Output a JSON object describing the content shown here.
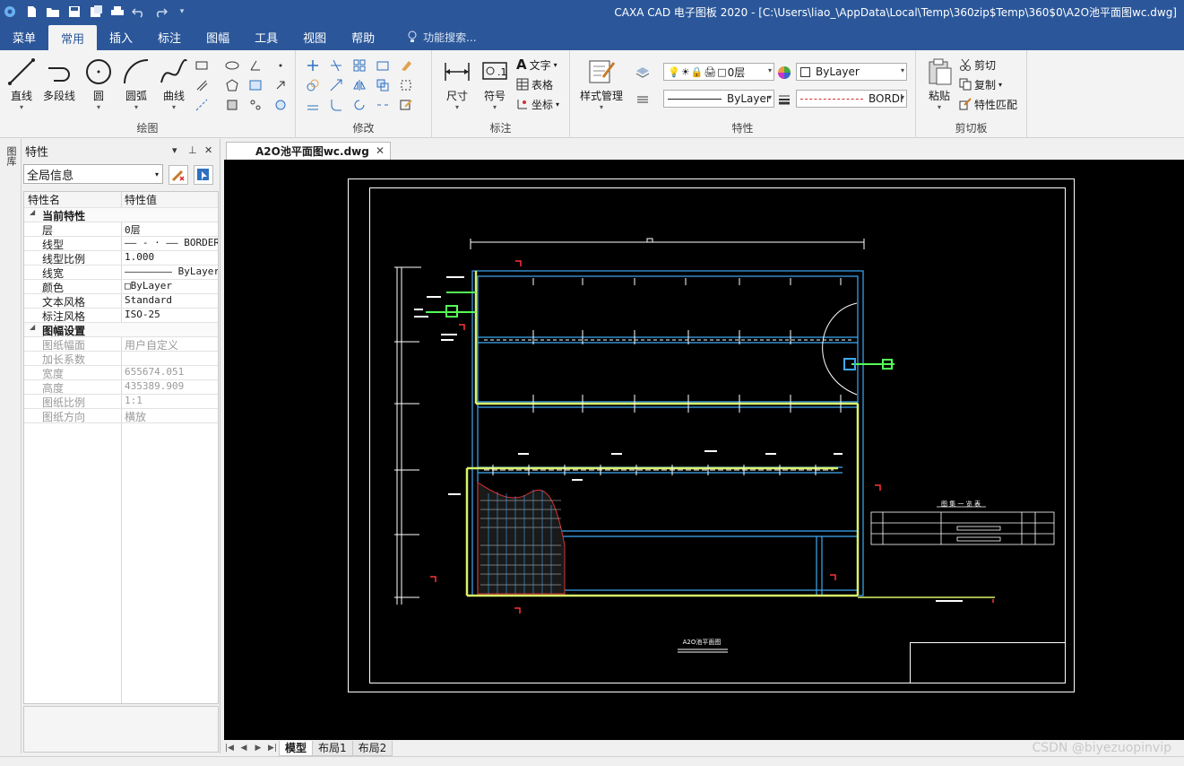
{
  "window": {
    "title": "CAXA CAD 电子图板 2020 - [C:\\Users\\liao_\\AppData\\Local\\Temp\\360zip$Temp\\360$0\\A2O池平面图wc.dwg]"
  },
  "menu": {
    "tabs": [
      "菜单",
      "常用",
      "插入",
      "标注",
      "图幅",
      "工具",
      "视图",
      "帮助"
    ],
    "active": "常用",
    "search_placeholder": "功能搜索..."
  },
  "ribbon": {
    "draw": {
      "group_label": "绘图",
      "line": "直线",
      "polyline": "多段线",
      "circle": "圆",
      "arc": "圆弧",
      "curve": "曲线"
    },
    "modify": {
      "group_label": "修改"
    },
    "annotate": {
      "group_label": "标注",
      "dimension": "尺寸",
      "symbol": "符号",
      "text": "文字",
      "table": "表格",
      "coord": "坐标"
    },
    "properties": {
      "group_label": "特性",
      "style_manager": "样式管理",
      "layer": "0层",
      "color": "ByLayer",
      "linetype": "ByLayer",
      "linetype2": "BORDI"
    },
    "clipboard": {
      "group_label": "剪切板",
      "paste": "粘贴",
      "cut": "剪切",
      "copy": "复制",
      "match": "特性匹配"
    }
  },
  "side_tab": "图库",
  "props": {
    "title": "特性",
    "scope": "全局信息",
    "col_name": "特性名",
    "col_value": "特性值",
    "cat1": "当前特性",
    "rows1": [
      {
        "name": "层",
        "value": "0层"
      },
      {
        "name": "线型",
        "value": "——  - · —— BORDER"
      },
      {
        "name": "线型比例",
        "value": "1.000"
      },
      {
        "name": "线宽",
        "value": "———————— ByLayer"
      },
      {
        "name": "颜色",
        "value": "□ByLayer"
      },
      {
        "name": "文本风格",
        "value": "Standard"
      },
      {
        "name": "标注风格",
        "value": "ISO-25"
      }
    ],
    "cat2": "图幅设置",
    "rows2": [
      {
        "name": "图纸幅面",
        "value": "用户自定义"
      },
      {
        "name": "加长系数",
        "value": ""
      },
      {
        "name": "宽度",
        "value": "655674.051"
      },
      {
        "name": "高度",
        "value": "435389.909"
      },
      {
        "name": "图纸比例",
        "value": "1:1"
      },
      {
        "name": "图纸方向",
        "value": "横放"
      }
    ]
  },
  "doc": {
    "tab": "A2O池平面图wc.dwg"
  },
  "layout_tabs": [
    "模型",
    "布局1",
    "布局2"
  ],
  "drawing": {
    "table_title": "图 集 一 览 表",
    "sheet_title": "A2O池平面图"
  },
  "watermark": "CSDN @biyezuopinvip"
}
